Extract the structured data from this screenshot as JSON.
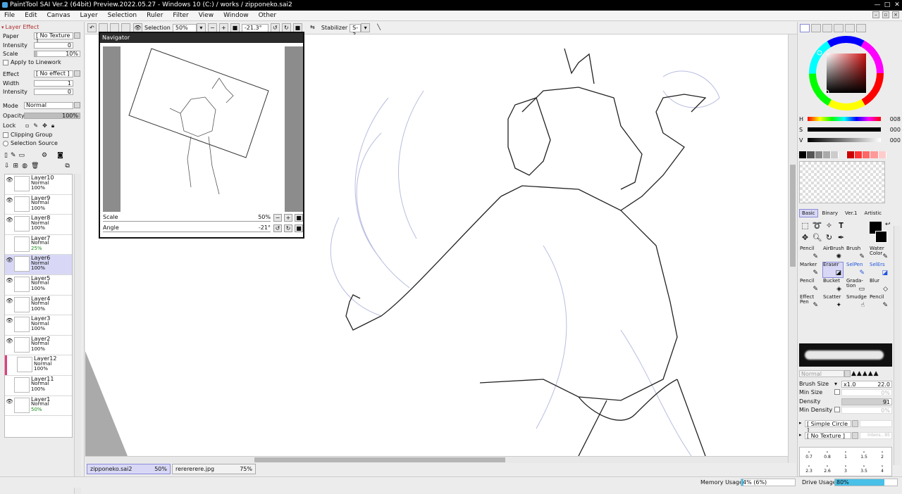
{
  "window": {
    "title": "PaintTool SAI Ver.2 (64bit) Preview.2022.05.27 - Windows 10 (C:) / works / zipponeko.sai2",
    "controls": [
      "—",
      "□",
      "✕"
    ]
  },
  "menu": [
    "File",
    "Edit",
    "Canvas",
    "Layer",
    "Selection",
    "Ruler",
    "Filter",
    "View",
    "Window",
    "Other"
  ],
  "layer_effect": {
    "header": "Layer Effect",
    "paper_label": "Paper",
    "paper_value": "[ No Texture ]",
    "intensity_label": "Intensity",
    "intensity_value": "0",
    "scale_label": "Scale",
    "scale_value": "10%",
    "apply_linework": "Apply to Linework",
    "effect_label": "Effect",
    "effect_value": "[ No effect ]",
    "width_label": "Width",
    "width_value": "1",
    "intensity2_label": "Intensity",
    "intensity2_value": "0",
    "mode_label": "Mode",
    "mode_value": "Normal",
    "opacity_label": "Opacity",
    "opacity_value": "100%",
    "lock_label": "Lock",
    "clipping_group": "Clipping Group",
    "selection_source": "Selection Source"
  },
  "layers": [
    {
      "name": "Layer10",
      "mode": "Normal",
      "opacity": "100%",
      "visible": true,
      "selected": false
    },
    {
      "name": "Layer9",
      "mode": "Normal",
      "opacity": "100%",
      "visible": true,
      "selected": false
    },
    {
      "name": "Layer8",
      "mode": "Normal",
      "opacity": "100%",
      "visible": true,
      "selected": false
    },
    {
      "name": "Layer7",
      "mode": "Normal",
      "opacity": "25%",
      "visible": false,
      "selected": false
    },
    {
      "name": "Layer6",
      "mode": "Normal",
      "opacity": "100%",
      "visible": true,
      "selected": true
    },
    {
      "name": "Layer5",
      "mode": "Normal",
      "opacity": "100%",
      "visible": true,
      "selected": false
    },
    {
      "name": "Layer4",
      "mode": "Normal",
      "opacity": "100%",
      "visible": true,
      "selected": false
    },
    {
      "name": "Layer3",
      "mode": "Normal",
      "opacity": "100%",
      "visible": true,
      "selected": false
    },
    {
      "name": "Layer2",
      "mode": "Normal",
      "opacity": "100%",
      "visible": true,
      "selected": false
    },
    {
      "name": "Layer12",
      "mode": "Normal",
      "opacity": "100%",
      "visible": false,
      "selected": false,
      "clipped": true
    },
    {
      "name": "Layer11",
      "mode": "Normal",
      "opacity": "100%",
      "visible": false,
      "selected": false
    },
    {
      "name": "Layer1",
      "mode": "Normal",
      "opacity": "50%",
      "visible": true,
      "selected": false
    }
  ],
  "toolbar": {
    "selection_label": "Selection",
    "zoom": "50%",
    "angle": "-21.3°",
    "stabilizer_label": "Stabilizer",
    "stabilizer_value": "S-3"
  },
  "navigator": {
    "title": "Navigator",
    "scale_label": "Scale",
    "scale_value": "50%",
    "angle_label": "Angle",
    "angle_value": "-21°"
  },
  "color": {
    "h_label": "H",
    "h_value": "008",
    "s_label": "S",
    "s_value": "000",
    "v_label": "V",
    "v_value": "000",
    "swatches": [
      "#000000",
      "#555555",
      "#888888",
      "#aaaaaa",
      "#cccccc",
      "#eeeeee",
      "#cc0000",
      "#ff3333",
      "#ff6666",
      "#ff9999",
      "#ffcccc"
    ]
  },
  "tool_tabs": [
    "Basic",
    "Binary",
    "Ver.1",
    "Artistic"
  ],
  "tools": [
    {
      "label": "Pencil",
      "glyph": "✎",
      "selected": false,
      "blue": false
    },
    {
      "label": "AirBrush",
      "glyph": "✺",
      "selected": false,
      "blue": false
    },
    {
      "label": "Brush",
      "glyph": "✎",
      "selected": false,
      "blue": false
    },
    {
      "label": "Water Color",
      "glyph": "✎",
      "selected": false,
      "blue": false
    },
    {
      "label": "Marker",
      "glyph": "✎",
      "selected": false,
      "blue": false
    },
    {
      "label": "Eraser",
      "glyph": "◪",
      "selected": true,
      "blue": false
    },
    {
      "label": "SelPen",
      "glyph": "✎",
      "selected": false,
      "blue": true
    },
    {
      "label": "SelErs",
      "glyph": "◪",
      "selected": false,
      "blue": true
    },
    {
      "label": "Pencil",
      "glyph": "✎",
      "selected": false,
      "blue": false
    },
    {
      "label": "Bucket",
      "glyph": "◈",
      "selected": false,
      "blue": false
    },
    {
      "label": "Grada-tion",
      "glyph": "▭",
      "selected": false,
      "blue": false
    },
    {
      "label": "Blur",
      "glyph": "◇",
      "selected": false,
      "blue": false
    },
    {
      "label": "Effect Pen",
      "glyph": "✎",
      "selected": false,
      "blue": false
    },
    {
      "label": "Scatter",
      "glyph": "✦",
      "selected": false,
      "blue": false
    },
    {
      "label": "Smudge",
      "glyph": "☝",
      "selected": false,
      "blue": false
    },
    {
      "label": "Pencil",
      "glyph": "✎",
      "selected": false,
      "blue": false
    }
  ],
  "brush": {
    "mode": "Normal",
    "size_label": "Brush Size",
    "size_mult": "x1.0",
    "size_value": "22.0",
    "min_size_label": "Min Size",
    "min_size_value": "0%",
    "density_label": "Density",
    "density_value": "91",
    "min_density_label": "Min Density",
    "min_density_value": "0%",
    "shape": "[ Simple Circle ]",
    "texture": "[ No Texture ]",
    "texture_intensity": "Intens...95",
    "sizes_row1": [
      "0.7",
      "0.8",
      "1",
      "1.5",
      "2"
    ],
    "sizes_row2": [
      "2.3",
      "2.6",
      "3",
      "3.5",
      "4"
    ]
  },
  "documents": [
    {
      "name": "zipponeko.sai2",
      "zoom": "50%",
      "active": true
    },
    {
      "name": "rerererere.jpg",
      "zoom": "75%",
      "active": false
    }
  ],
  "status": {
    "memory_label": "Memory Usage",
    "memory_value": "4% (6%)",
    "memory_fill": 0.04,
    "drive_label": "Drive Usage",
    "drive_value": "80%",
    "drive_fill": 0.8
  }
}
